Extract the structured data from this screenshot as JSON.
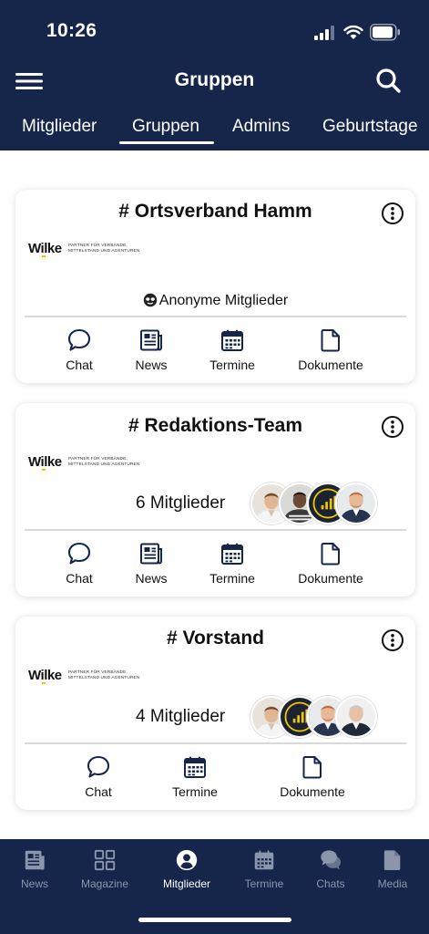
{
  "status_bar": {
    "time": "10:26",
    "signal_icon": "cellular-signal-icon",
    "wifi_icon": "wifi-icon",
    "battery_icon": "battery-icon"
  },
  "header": {
    "title": "Gruppen",
    "menu_icon": "hamburger-menu-icon",
    "search_icon": "search-icon",
    "background": "#16264b"
  },
  "tabs": [
    {
      "label": "Mitglieder",
      "active": false
    },
    {
      "label": "Gruppen",
      "active": true
    },
    {
      "label": "Admins",
      "active": false
    },
    {
      "label": "Geburtstage",
      "active": false
    }
  ],
  "logo": {
    "brand": "Wilke",
    "tagline_1": "PARTNER FÜR VERBÄNDE,",
    "tagline_2": "MITTELSTAND UND AGENTUREN",
    "accent": "#f2c500"
  },
  "groups": [
    {
      "title": "# Ortsverband Hamm",
      "members_text": "Anonyme Mitglieder",
      "anonymous": true,
      "actions": [
        {
          "label": "Chat",
          "icon": "chat-bubble-icon"
        },
        {
          "label": "News",
          "icon": "newspaper-icon"
        },
        {
          "label": "Termine",
          "icon": "calendar-icon"
        },
        {
          "label": "Dokumente",
          "icon": "document-icon"
        }
      ]
    },
    {
      "title": "# Redaktions-Team",
      "members_text": "6 Mitglieder",
      "anonymous": false,
      "actions": [
        {
          "label": "Chat",
          "icon": "chat-bubble-icon"
        },
        {
          "label": "News",
          "icon": "newspaper-icon"
        },
        {
          "label": "Termine",
          "icon": "calendar-icon"
        },
        {
          "label": "Dokumente",
          "icon": "document-icon"
        }
      ]
    },
    {
      "title": "# Vorstand",
      "members_text": "4 Mitglieder",
      "anonymous": false,
      "actions": [
        {
          "label": "Chat",
          "icon": "chat-bubble-icon"
        },
        {
          "label": "Termine",
          "icon": "calendar-icon"
        },
        {
          "label": "Dokumente",
          "icon": "document-icon"
        }
      ]
    }
  ],
  "bottom_nav": [
    {
      "label": "News",
      "icon": "newspaper-icon",
      "active": false
    },
    {
      "label": "Magazine",
      "icon": "grid-icon",
      "active": false
    },
    {
      "label": "Mitglieder",
      "icon": "user-circle-icon",
      "active": true
    },
    {
      "label": "Termine",
      "icon": "calendar-icon",
      "active": false
    },
    {
      "label": "Chats",
      "icon": "chat-bubbles-icon",
      "active": false
    },
    {
      "label": "Media",
      "icon": "document-icon",
      "active": false
    }
  ],
  "colors": {
    "nav_bg": "#16264b",
    "nav_inactive": "#8b96ad",
    "nav_active": "#ffffff",
    "divider": "#d9d9d9"
  }
}
